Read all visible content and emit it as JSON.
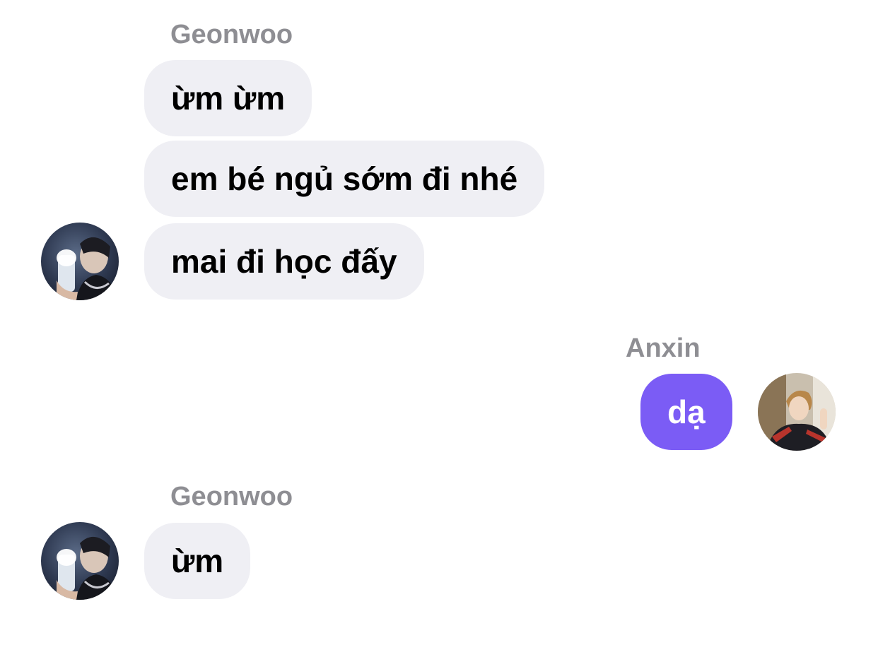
{
  "conversation": {
    "groups": [
      {
        "sender": "Geonwoo",
        "messages": [
          "ừm ừm",
          "em bé ngủ sớm đi nhé",
          "mai đi học đấy"
        ]
      },
      {
        "sender": "Anxin",
        "messages": [
          "dạ"
        ]
      },
      {
        "sender": "Geonwoo",
        "messages": [
          "ừm"
        ]
      }
    ]
  },
  "colors": {
    "incoming_bubble": "#efeff4",
    "outgoing_bubble": "#7b5cf5",
    "sender_name": "#8e8e93"
  },
  "icons": {
    "geonwoo_avatar": "avatar-photo-mirror-selfie",
    "anxin_avatar": "avatar-photo-portrait"
  }
}
